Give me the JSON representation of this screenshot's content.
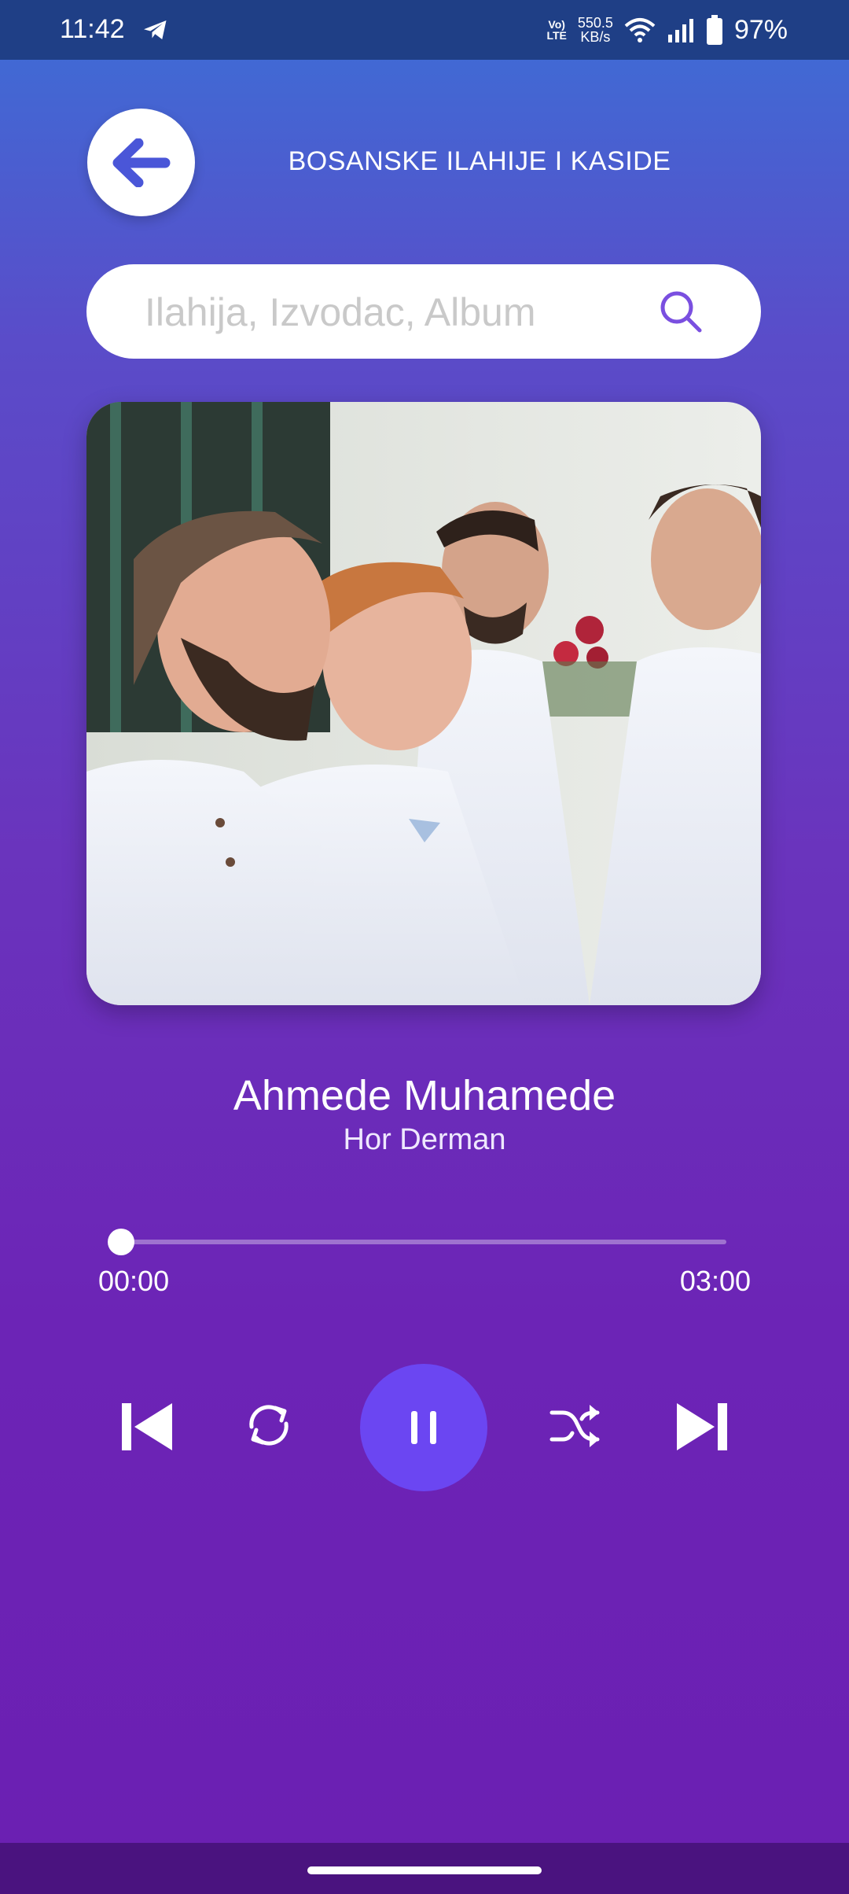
{
  "status_bar": {
    "time": "11:42",
    "network_top": "Vo)",
    "network_bottom": "LTE",
    "speed_value": "550.5",
    "speed_unit": "KB/s",
    "battery": "97%",
    "icons": [
      "telegram-icon",
      "volte-icon",
      "wifi-icon",
      "signal-icon",
      "battery-icon"
    ]
  },
  "header": {
    "title": "BOSANSKE ILAHIJE I KASIDE",
    "back_icon": "arrow-left-icon"
  },
  "search": {
    "placeholder": "Ilahija, Izvodac, Album",
    "value": "",
    "icon": "search-icon"
  },
  "player": {
    "song_title": "Ahmede Muhamede",
    "artist": "Hor Derman",
    "current_time": "00:00",
    "duration": "03:00",
    "progress": 0.0
  },
  "controls": [
    "previous-icon",
    "repeat-icon",
    "pause-icon",
    "shuffle-icon",
    "next-icon"
  ],
  "colors": {
    "gradient_top": "#3c6fd6",
    "gradient_bottom": "#6b1fb2",
    "accent": "#6b46f2",
    "status_bar": "#1f3f86",
    "nav_bar": "#4a137f"
  }
}
